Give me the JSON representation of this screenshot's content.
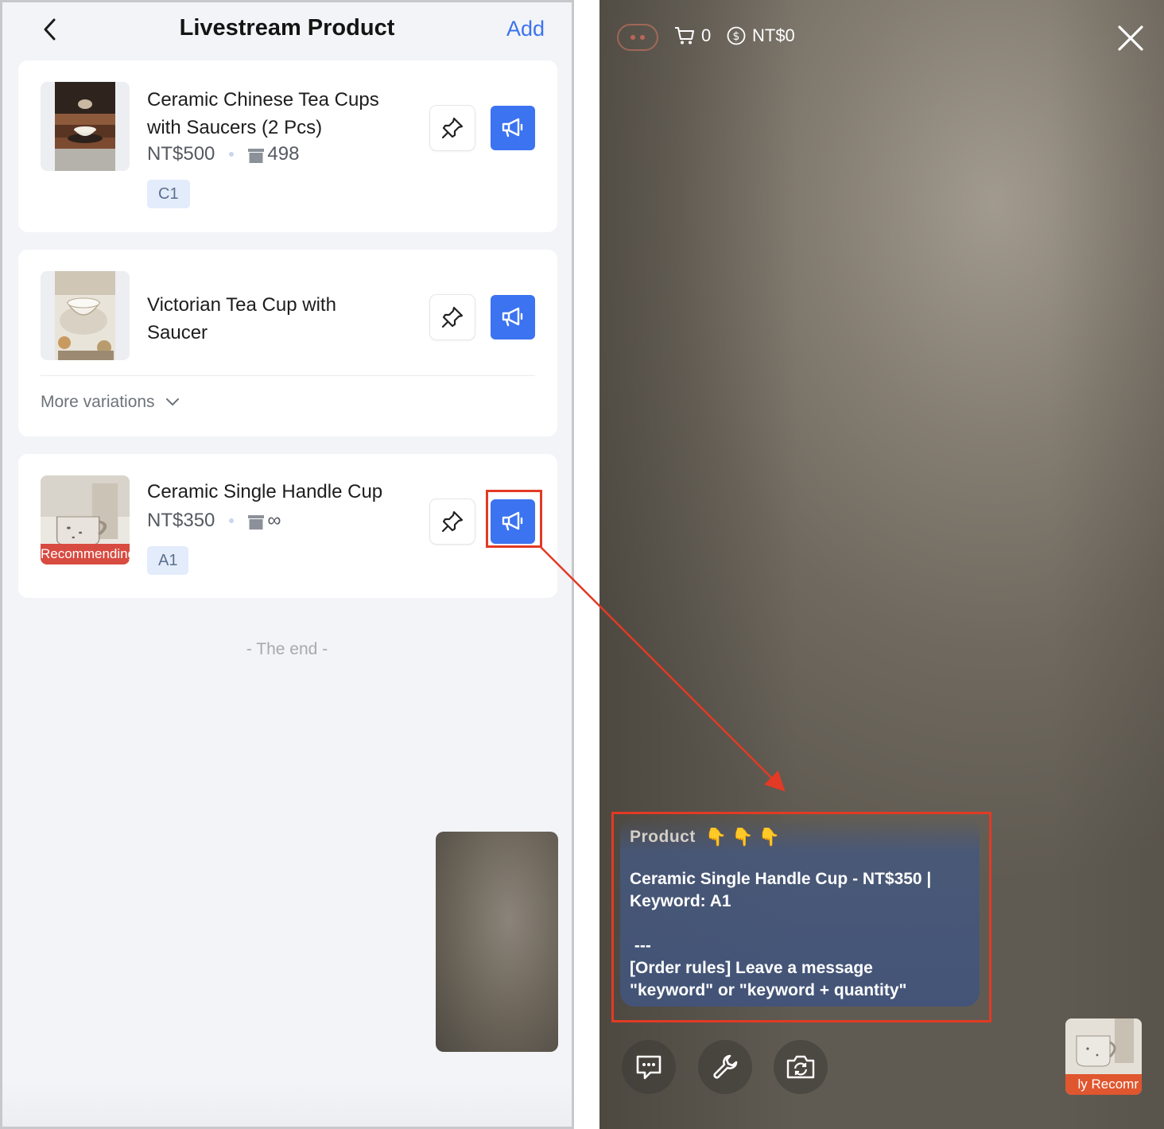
{
  "header": {
    "title": "Livestream Product",
    "add_label": "Add"
  },
  "products": [
    {
      "name": "Ceramic Chinese Tea Cups with Saucers (2 Pcs)",
      "price": "NT$500",
      "stock": "498",
      "keyword": "C1"
    },
    {
      "name": "Victorian Tea Cup with Saucer",
      "more_variations": "More variations"
    },
    {
      "name": "Ceramic Single Handle Cup",
      "price": "NT$350",
      "stock": "∞",
      "keyword": "A1",
      "ribbon": "Recommending"
    }
  ],
  "list_end": "- The end -",
  "live": {
    "cart_count": "0",
    "revenue": "NT$0",
    "chat_author": "Product",
    "chat_emojis": "👇👇👇",
    "chat_message": "Ceramic Single Handle Cup - NT$350 |\nKeyword: A1\n\n ---\n[Order rules] Leave a message\n\"keyword\" or \"keyword + quantity\"",
    "recommend_strip": "ly Recomr"
  },
  "colors": {
    "accent": "#3b73f0",
    "annotation": "#e23a24",
    "ribbon": "#d84b41"
  }
}
